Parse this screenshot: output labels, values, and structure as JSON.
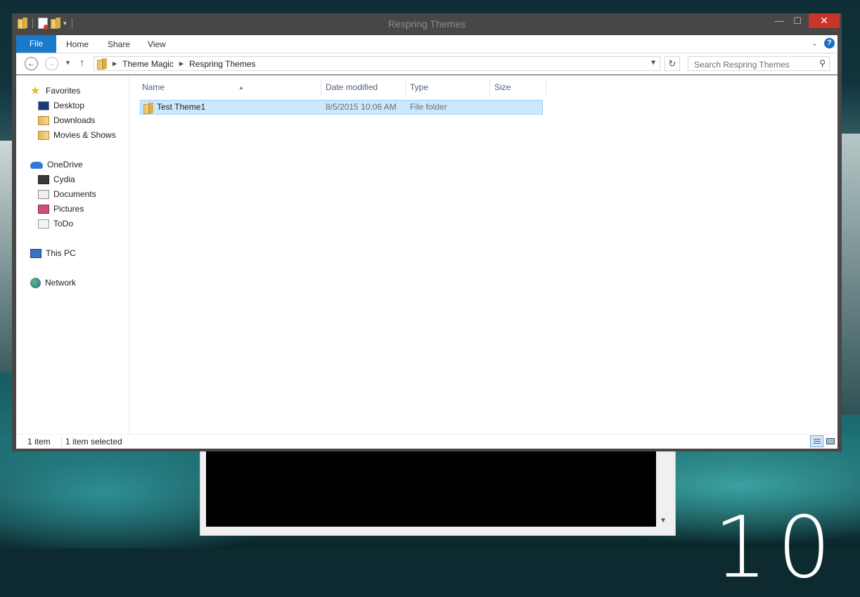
{
  "window": {
    "title": "Respring Themes",
    "controls": {
      "minimize": "—",
      "maximize": "☐",
      "close": "✕"
    }
  },
  "ribbon": {
    "file_tab": "File",
    "tabs": [
      "Home",
      "Share",
      "View"
    ],
    "help": "?"
  },
  "address": {
    "breadcrumb": [
      "Theme Magic",
      "Respring Themes"
    ],
    "search_placeholder": "Search Respring Themes"
  },
  "sidebar": {
    "favorites": {
      "label": "Favorites",
      "items": [
        "Desktop",
        "Downloads",
        "Movies & Shows"
      ]
    },
    "onedrive": {
      "label": "OneDrive",
      "items": [
        "Cydia",
        "Documents",
        "Pictures",
        "ToDo"
      ]
    },
    "this_pc": "This PC",
    "network": "Network"
  },
  "columns": [
    "Name",
    "Date modified",
    "Type",
    "Size"
  ],
  "rows": [
    {
      "name": "Test Theme1",
      "date": "8/5/2015 10:06 AM",
      "type": "File folder",
      "size": ""
    }
  ],
  "status": {
    "item_count": "1 item",
    "selected": "1 item selected"
  },
  "desktop": {
    "clock_fragment": "10"
  },
  "colors": {
    "accent": "#1979ca",
    "selection": "#cce8ff",
    "close": "#c7352a"
  }
}
